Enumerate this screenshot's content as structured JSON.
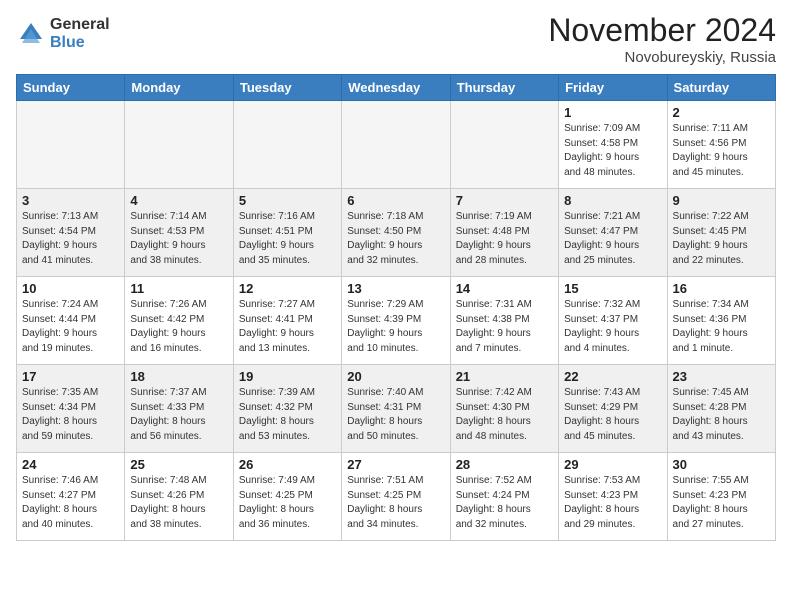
{
  "header": {
    "logo_general": "General",
    "logo_blue": "Blue",
    "month_title": "November 2024",
    "location": "Novobureyskiy, Russia"
  },
  "days_of_week": [
    "Sunday",
    "Monday",
    "Tuesday",
    "Wednesday",
    "Thursday",
    "Friday",
    "Saturday"
  ],
  "weeks": [
    {
      "alt": false,
      "days": [
        {
          "num": "",
          "info": ""
        },
        {
          "num": "",
          "info": ""
        },
        {
          "num": "",
          "info": ""
        },
        {
          "num": "",
          "info": ""
        },
        {
          "num": "",
          "info": ""
        },
        {
          "num": "1",
          "info": "Sunrise: 7:09 AM\nSunset: 4:58 PM\nDaylight: 9 hours\nand 48 minutes."
        },
        {
          "num": "2",
          "info": "Sunrise: 7:11 AM\nSunset: 4:56 PM\nDaylight: 9 hours\nand 45 minutes."
        }
      ]
    },
    {
      "alt": true,
      "days": [
        {
          "num": "3",
          "info": "Sunrise: 7:13 AM\nSunset: 4:54 PM\nDaylight: 9 hours\nand 41 minutes."
        },
        {
          "num": "4",
          "info": "Sunrise: 7:14 AM\nSunset: 4:53 PM\nDaylight: 9 hours\nand 38 minutes."
        },
        {
          "num": "5",
          "info": "Sunrise: 7:16 AM\nSunset: 4:51 PM\nDaylight: 9 hours\nand 35 minutes."
        },
        {
          "num": "6",
          "info": "Sunrise: 7:18 AM\nSunset: 4:50 PM\nDaylight: 9 hours\nand 32 minutes."
        },
        {
          "num": "7",
          "info": "Sunrise: 7:19 AM\nSunset: 4:48 PM\nDaylight: 9 hours\nand 28 minutes."
        },
        {
          "num": "8",
          "info": "Sunrise: 7:21 AM\nSunset: 4:47 PM\nDaylight: 9 hours\nand 25 minutes."
        },
        {
          "num": "9",
          "info": "Sunrise: 7:22 AM\nSunset: 4:45 PM\nDaylight: 9 hours\nand 22 minutes."
        }
      ]
    },
    {
      "alt": false,
      "days": [
        {
          "num": "10",
          "info": "Sunrise: 7:24 AM\nSunset: 4:44 PM\nDaylight: 9 hours\nand 19 minutes."
        },
        {
          "num": "11",
          "info": "Sunrise: 7:26 AM\nSunset: 4:42 PM\nDaylight: 9 hours\nand 16 minutes."
        },
        {
          "num": "12",
          "info": "Sunrise: 7:27 AM\nSunset: 4:41 PM\nDaylight: 9 hours\nand 13 minutes."
        },
        {
          "num": "13",
          "info": "Sunrise: 7:29 AM\nSunset: 4:39 PM\nDaylight: 9 hours\nand 10 minutes."
        },
        {
          "num": "14",
          "info": "Sunrise: 7:31 AM\nSunset: 4:38 PM\nDaylight: 9 hours\nand 7 minutes."
        },
        {
          "num": "15",
          "info": "Sunrise: 7:32 AM\nSunset: 4:37 PM\nDaylight: 9 hours\nand 4 minutes."
        },
        {
          "num": "16",
          "info": "Sunrise: 7:34 AM\nSunset: 4:36 PM\nDaylight: 9 hours\nand 1 minute."
        }
      ]
    },
    {
      "alt": true,
      "days": [
        {
          "num": "17",
          "info": "Sunrise: 7:35 AM\nSunset: 4:34 PM\nDaylight: 8 hours\nand 59 minutes."
        },
        {
          "num": "18",
          "info": "Sunrise: 7:37 AM\nSunset: 4:33 PM\nDaylight: 8 hours\nand 56 minutes."
        },
        {
          "num": "19",
          "info": "Sunrise: 7:39 AM\nSunset: 4:32 PM\nDaylight: 8 hours\nand 53 minutes."
        },
        {
          "num": "20",
          "info": "Sunrise: 7:40 AM\nSunset: 4:31 PM\nDaylight: 8 hours\nand 50 minutes."
        },
        {
          "num": "21",
          "info": "Sunrise: 7:42 AM\nSunset: 4:30 PM\nDaylight: 8 hours\nand 48 minutes."
        },
        {
          "num": "22",
          "info": "Sunrise: 7:43 AM\nSunset: 4:29 PM\nDaylight: 8 hours\nand 45 minutes."
        },
        {
          "num": "23",
          "info": "Sunrise: 7:45 AM\nSunset: 4:28 PM\nDaylight: 8 hours\nand 43 minutes."
        }
      ]
    },
    {
      "alt": false,
      "days": [
        {
          "num": "24",
          "info": "Sunrise: 7:46 AM\nSunset: 4:27 PM\nDaylight: 8 hours\nand 40 minutes."
        },
        {
          "num": "25",
          "info": "Sunrise: 7:48 AM\nSunset: 4:26 PM\nDaylight: 8 hours\nand 38 minutes."
        },
        {
          "num": "26",
          "info": "Sunrise: 7:49 AM\nSunset: 4:25 PM\nDaylight: 8 hours\nand 36 minutes."
        },
        {
          "num": "27",
          "info": "Sunrise: 7:51 AM\nSunset: 4:25 PM\nDaylight: 8 hours\nand 34 minutes."
        },
        {
          "num": "28",
          "info": "Sunrise: 7:52 AM\nSunset: 4:24 PM\nDaylight: 8 hours\nand 32 minutes."
        },
        {
          "num": "29",
          "info": "Sunrise: 7:53 AM\nSunset: 4:23 PM\nDaylight: 8 hours\nand 29 minutes."
        },
        {
          "num": "30",
          "info": "Sunrise: 7:55 AM\nSunset: 4:23 PM\nDaylight: 8 hours\nand 27 minutes."
        }
      ]
    }
  ]
}
